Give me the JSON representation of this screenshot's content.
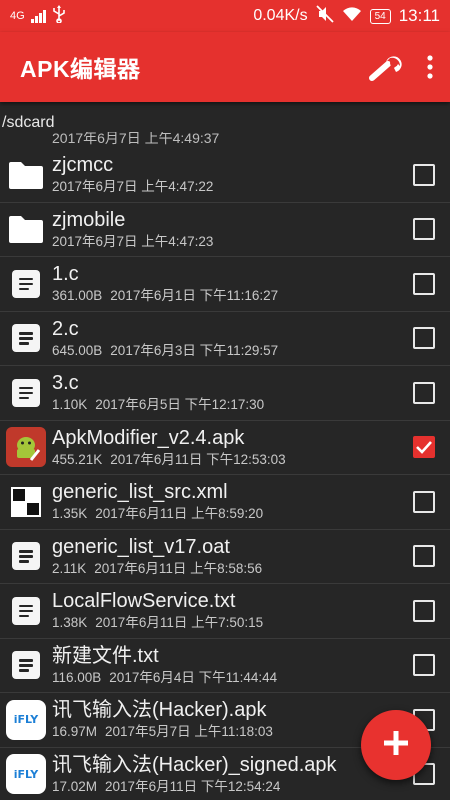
{
  "status_bar": {
    "network": "4G",
    "speed": "0.04K/s",
    "battery": "54",
    "time": "13:11",
    "color": "#e5312e"
  },
  "app_bar": {
    "title": "APK编辑器",
    "tool_icon": "wrench-icon",
    "more_icon": "more-vert-icon"
  },
  "path": "/sdcard",
  "partial_row_date": "2017年6月7日 上午4:49:37",
  "files": [
    {
      "name": "zjcmcc",
      "size": "",
      "date": "2017年6月7日 上午4:47:22",
      "type": "folder",
      "checked": false
    },
    {
      "name": "zjmobile",
      "size": "",
      "date": "2017年6月7日 上午4:47:23",
      "type": "folder",
      "checked": false
    },
    {
      "name": "1.c",
      "size": "361.00B",
      "date": "2017年6月1日 下午11:16:27",
      "type": "doc",
      "checked": false
    },
    {
      "name": "2.c",
      "size": "645.00B",
      "date": "2017年6月3日 下午11:29:57",
      "type": "doc",
      "checked": false
    },
    {
      "name": "3.c",
      "size": "1.10K",
      "date": "2017年6月5日 下午12:17:30",
      "type": "doc",
      "checked": false
    },
    {
      "name": "ApkModifier_v2.4.apk",
      "size": "455.21K",
      "date": "2017年6月11日 下午12:53:03",
      "type": "apk",
      "checked": true
    },
    {
      "name": "generic_list_src.xml",
      "size": "1.35K",
      "date": "2017年6月11日 上午8:59:20",
      "type": "xml",
      "checked": false
    },
    {
      "name": "generic_list_v17.oat",
      "size": "2.11K",
      "date": "2017年6月11日 上午8:58:56",
      "type": "doc",
      "checked": false
    },
    {
      "name": "LocalFlowService.txt",
      "size": "1.38K",
      "date": "2017年6月11日 上午7:50:15",
      "type": "doc",
      "checked": false
    },
    {
      "name": "新建文件.txt",
      "size": "116.00B",
      "date": "2017年6月4日 下午11:44:44",
      "type": "doc",
      "checked": false
    },
    {
      "name": "讯飞输入法(Hacker).apk",
      "size": "16.97M",
      "date": "2017年5月7日 上午11:18:03",
      "type": "ifly",
      "checked": false
    },
    {
      "name": "讯飞输入法(Hacker)_signed.apk",
      "size": "17.02M",
      "date": "2017年6月11日 下午12:54:24",
      "type": "ifly",
      "checked": false
    }
  ],
  "ifly_label": "iFLY",
  "fab": {
    "label": "+",
    "icon": "add-icon",
    "color": "#e8322f"
  }
}
